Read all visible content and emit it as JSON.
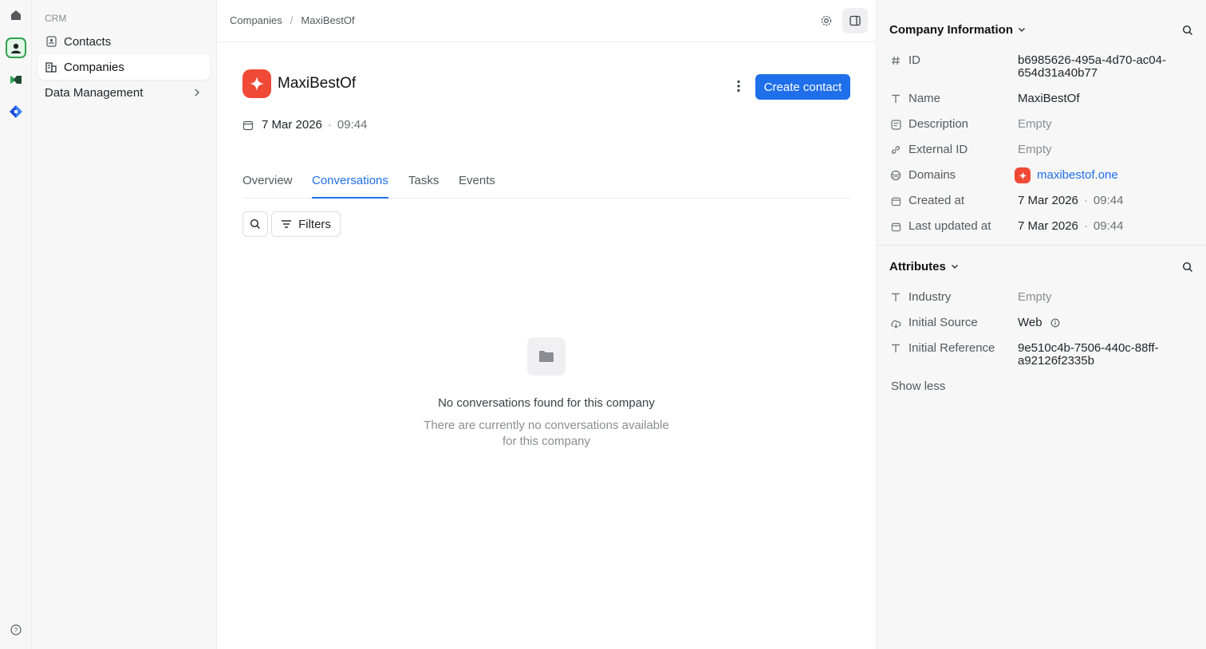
{
  "sidebar": {
    "section_label": "CRM",
    "items": [
      {
        "label": "Contacts",
        "icon": "contact-book-icon"
      },
      {
        "label": "Companies",
        "icon": "building-icon",
        "active": true
      },
      {
        "label": "Data Management",
        "icon": "chevron-right-icon"
      }
    ]
  },
  "breadcrumb": {
    "parent": "Companies",
    "separator": "/",
    "current": "MaxiBestOf"
  },
  "company": {
    "name": "MaxiBestOf",
    "date": "7 Mar 2026",
    "time": "09:44",
    "logo_color": "#f04a36"
  },
  "actions": {
    "create_contact": "Create contact"
  },
  "tabs": [
    {
      "label": "Overview"
    },
    {
      "label": "Conversations",
      "active": true
    },
    {
      "label": "Tasks"
    },
    {
      "label": "Events"
    }
  ],
  "toolbar": {
    "filters_label": "Filters"
  },
  "empty_state": {
    "title": "No conversations found for this company",
    "description": "There are currently no conversations available for this company"
  },
  "company_info": {
    "title": "Company Information",
    "fields": {
      "id": {
        "label": "ID",
        "value": "b6985626-495a-4d70-ac04-654d31a40b77"
      },
      "name": {
        "label": "Name",
        "value": "MaxiBestOf"
      },
      "description": {
        "label": "Description",
        "value": "Empty"
      },
      "external_id": {
        "label": "External ID",
        "value": "Empty"
      },
      "domains": {
        "label": "Domains",
        "value": "maxibestof.one"
      },
      "created_at": {
        "label": "Created at",
        "date": "7 Mar 2026",
        "time": "09:44"
      },
      "last_updated_at": {
        "label": "Last updated at",
        "date": "7 Mar 2026",
        "time": "09:44"
      }
    }
  },
  "attributes": {
    "title": "Attributes",
    "fields": {
      "industry": {
        "label": "Industry",
        "value": "Empty"
      },
      "initial_source": {
        "label": "Initial Source",
        "value": "Web"
      },
      "initial_reference": {
        "label": "Initial Reference",
        "value": "9e510c4b-7506-440c-88ff-a92126f2335b"
      }
    },
    "show_less": "Show less"
  },
  "colors": {
    "accent": "#1f6feb",
    "brand": "#f04a36",
    "active_app": "#2ea44f"
  }
}
